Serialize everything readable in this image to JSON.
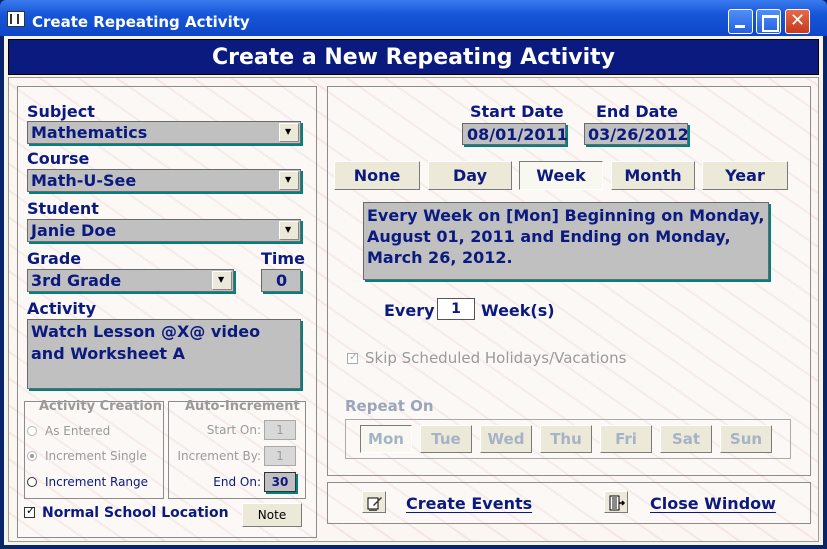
{
  "window": {
    "title": "Create Repeating Activity"
  },
  "banner": {
    "title": "Create a New Repeating Activity"
  },
  "left": {
    "subject_label": "Subject",
    "subject_value": "Mathematics",
    "course_label": "Course",
    "course_value": "Math-U-See",
    "student_label": "Student",
    "student_value": "Janie Doe",
    "grade_label": "Grade",
    "grade_value": "3rd Grade",
    "time_label": "Time",
    "time_value": "0",
    "activity_label": "Activity",
    "activity_line1": "Watch Lesson @X@ video",
    "activity_line2": "and Worksheet A",
    "creation": {
      "title": "Activity Creation",
      "opt1": "As Entered",
      "opt2": "Increment Single",
      "opt3": "Increment Range"
    },
    "increment": {
      "title": "Auto-Increment",
      "start_label": "Start On:",
      "start_value": "1",
      "by_label": "Increment By:",
      "by_value": "1",
      "end_label": "End On:",
      "end_value": "30"
    },
    "normal_location_label": "Normal School Location",
    "note_label": "Note"
  },
  "right": {
    "start_label": "Start Date",
    "start_value": "08/01/2011",
    "end_label": "End Date",
    "end_value": "03/26/2012",
    "freq": {
      "none": "None",
      "day": "Day",
      "week": "Week",
      "month": "Month",
      "year": "Year"
    },
    "description_l1": "Every Week on [Mon] Beginning on Monday,",
    "description_l2": "August 01, 2011 and Ending on Monday,",
    "description_l3": "March 26, 2012.",
    "every_label": "Every",
    "every_value": "1",
    "every_unit": "Week(s)",
    "skip_label": "Skip Scheduled Holidays/Vacations",
    "repeat_on_label": "Repeat On",
    "days": {
      "mon": "Mon",
      "tue": "Tue",
      "wed": "Wed",
      "thu": "Thu",
      "fri": "Fri",
      "sat": "Sat",
      "sun": "Sun"
    }
  },
  "actions": {
    "create_events": "Create Events",
    "close_window": "Close Window"
  }
}
